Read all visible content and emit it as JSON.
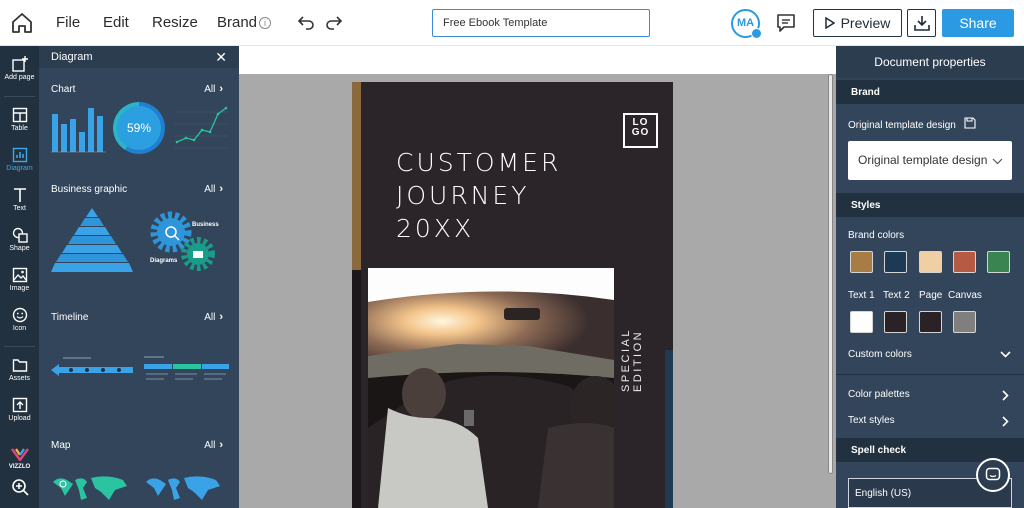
{
  "topbar": {
    "menus": [
      "File",
      "Edit",
      "Resize",
      "Brand"
    ],
    "doc_title": "Free Ebook Template",
    "avatar_initials": "MA",
    "preview_label": "Preview",
    "share_label": "Share"
  },
  "iconbar": {
    "items": [
      {
        "label": "Add page",
        "icon": "add-page-icon"
      },
      {
        "label": "Table",
        "icon": "table-icon"
      },
      {
        "label": "Diagram",
        "icon": "chart-icon"
      },
      {
        "label": "Text",
        "icon": "text-icon"
      },
      {
        "label": "Shape",
        "icon": "shape-icon"
      },
      {
        "label": "Image",
        "icon": "image-icon"
      },
      {
        "label": "Icon",
        "icon": "smiley-icon"
      },
      {
        "label": "Assets",
        "icon": "folder-icon"
      },
      {
        "label": "Upload",
        "icon": "upload-icon"
      }
    ],
    "brand_label": "VIZZLO"
  },
  "panel": {
    "title": "Diagram",
    "sections": [
      {
        "title": "Chart",
        "all": "All"
      },
      {
        "title": "Business graphic",
        "all": "All"
      },
      {
        "title": "Timeline",
        "all": "All"
      },
      {
        "title": "Map",
        "all": "All"
      }
    ],
    "donut_value": "59%",
    "gear_labels": [
      "Business",
      "Diagrams"
    ]
  },
  "page": {
    "logo_text": "LOGO",
    "heading_lines": [
      "CUSTOMER",
      "JOURNEY",
      "20XX"
    ],
    "side_text": "SPECIAL EDITION"
  },
  "props": {
    "title": "Document properties",
    "brand_section": "Brand",
    "original_label": "Original template design",
    "original_select": "Original template design",
    "styles_section": "Styles",
    "brand_colors_label": "Brand colors",
    "brand_colors": [
      "#a87c45",
      "#1d3a55",
      "#f1cfa5",
      "#b65a43",
      "#3a8451"
    ],
    "text_color_labels": [
      "Text 1",
      "Text 2",
      "Page",
      "Canvas"
    ],
    "text_colors": [
      "#ffffff",
      "#2a2227",
      "#2a2227",
      "#7f7f7f"
    ],
    "custom_colors_label": "Custom colors",
    "color_palettes_label": "Color palettes",
    "text_styles_label": "Text styles",
    "spell_section": "Spell check",
    "language": "English (US)"
  }
}
